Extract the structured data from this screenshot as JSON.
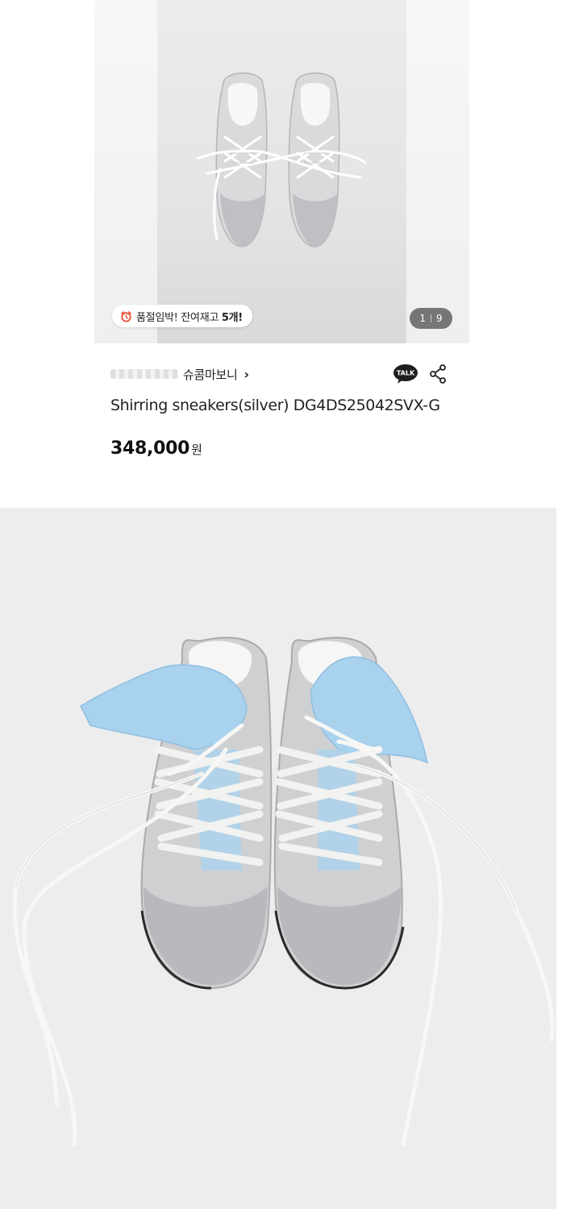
{
  "gallery": {
    "stock_badge": {
      "prefix": "품절임박! 잔여재고 ",
      "count": "5개!"
    },
    "pager": {
      "current": "1",
      "total": "9"
    }
  },
  "product": {
    "brand": "슈콤마보니",
    "title": "Shirring sneakers(silver) DG4DS25042SVX-G",
    "price": "348,000",
    "currency": "원"
  },
  "icons": {
    "talk": "TALK",
    "talk_icon": "kakaotalk-icon",
    "share_icon": "share-icon",
    "badge_icon": "alarm-clock-icon"
  },
  "colors": {
    "badge_clock": "#e8452c",
    "pager_bg": "#464646",
    "talk_bg": "#1e1e1e",
    "sock_blue": "#a9d2ee",
    "shoe_silver": "#cfd0d2"
  }
}
